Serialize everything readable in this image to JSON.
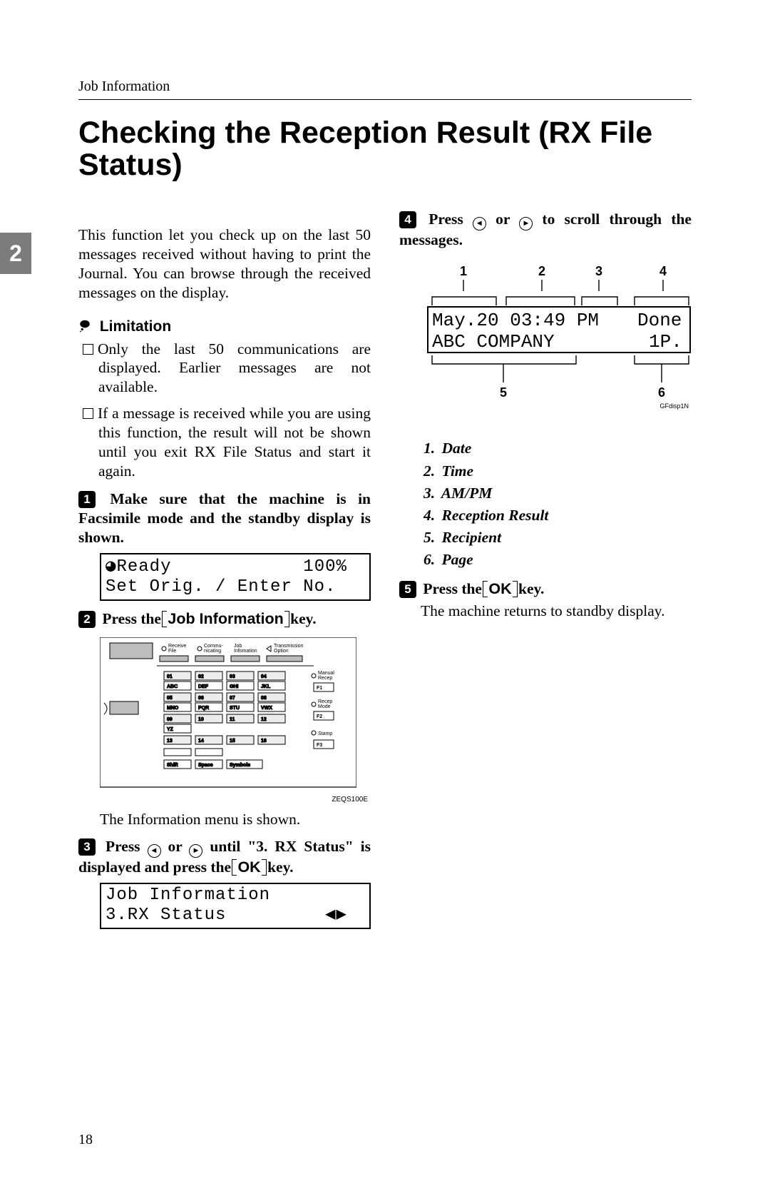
{
  "header": {
    "running": "Job Information"
  },
  "title": "Checking the Reception Result (RX File Status)",
  "section_tab": "2",
  "page_number": "18",
  "col_left": {
    "intro": "This function let you check up on the last 50 messages received without having to print the Journal. You can browse through the received messages on the display.",
    "limitation_heading": "Limitation",
    "limitations": [
      "Only the last 50 communications are displayed. Earlier messages are not available.",
      "If a message is received while you are using this function, the result will not be shown until you exit RX File Status and start it again."
    ],
    "step1": {
      "text": "Make sure that the machine is in Facsimile mode and the standby display is shown."
    },
    "lcd1": {
      "line1_left": "Ready",
      "line1_right": "100%",
      "line2": "Set Orig. / Enter No."
    },
    "step2": {
      "prefix": "Press the ",
      "key": "Job Information",
      "suffix": " key."
    },
    "panel": {
      "top_labels": [
        "Receive File",
        "Communicating",
        "Job Infomation",
        "Transmission Option"
      ],
      "keypad_rows": [
        [
          "01",
          "02",
          "03",
          "04"
        ],
        [
          "ABC",
          "DEF",
          "GHI",
          "JKL"
        ],
        [
          "05",
          "06",
          "07",
          "08"
        ],
        [
          "MNO",
          "PQR",
          "STU",
          "VWX"
        ],
        [
          "09",
          "10",
          "11",
          "12"
        ],
        [
          "YZ",
          "",
          "",
          ""
        ],
        [
          "13",
          "14",
          "15",
          "16"
        ]
      ],
      "bottom_row": [
        "Shift",
        "Space",
        "Symbols"
      ],
      "side_labels": [
        "Manual Recep",
        "Recep Mode",
        "Stamp"
      ],
      "fkeys": [
        "F1",
        "F2",
        "F3"
      ],
      "fig_code": "ZEQS100E"
    },
    "after_panel": "The Information menu is shown.",
    "step3": {
      "part1": "Press ",
      "mid": " or ",
      "part2": " until \"3. RX Status\" is displayed and press the ",
      "key": "OK",
      "suffix": " key."
    },
    "lcd2": {
      "line1": "Job Information",
      "line2": "3.RX Status"
    }
  },
  "col_right": {
    "step4": {
      "part1": "Press ",
      "mid": " or ",
      "part2": " to scroll through the messages."
    },
    "display": {
      "top_callouts": [
        "1",
        "2",
        "3",
        "4"
      ],
      "row1_left": "May.20 03:49 PM",
      "row1_right": "Done",
      "row2_left": "ABC COMPANY",
      "row2_right": "1P.",
      "bottom_callouts": [
        "5",
        "6"
      ],
      "fig_code": "GFdisp1N"
    },
    "callouts": [
      "Date",
      "Time",
      "AM/PM",
      "Reception Result",
      "Recipient",
      "Page"
    ],
    "step5": {
      "prefix": "Press the ",
      "key": "OK",
      "suffix": " key."
    },
    "after5": "The machine returns to standby display."
  }
}
